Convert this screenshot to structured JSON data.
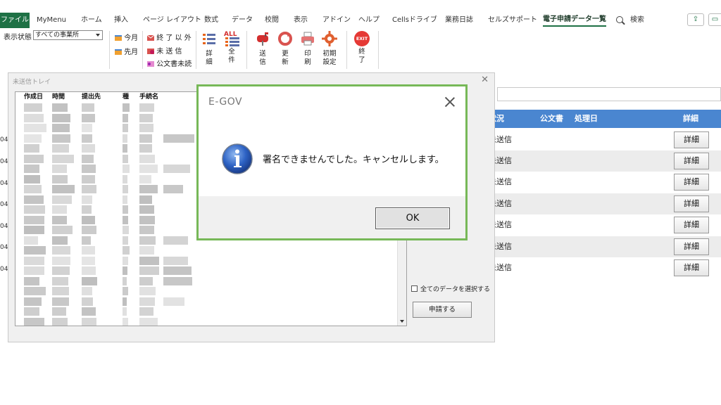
{
  "tabs": {
    "file": "ファイル",
    "items": [
      {
        "key": "mymenu",
        "label": "MyMenu"
      },
      {
        "key": "home",
        "label": "ホーム"
      },
      {
        "key": "insert",
        "label": "挿入"
      },
      {
        "key": "page_layout",
        "label": "ページ レイアウト"
      },
      {
        "key": "formulas",
        "label": "数式"
      },
      {
        "key": "data",
        "label": "データ"
      },
      {
        "key": "review",
        "label": "校閲"
      },
      {
        "key": "view",
        "label": "表示"
      },
      {
        "key": "addins",
        "label": "アドイン"
      },
      {
        "key": "help",
        "label": "ヘルプ"
      },
      {
        "key": "cells_drive",
        "label": "Cellsドライブ"
      },
      {
        "key": "business_log",
        "label": "業務日誌"
      },
      {
        "key": "cells_support",
        "label": "セルズサポート"
      },
      {
        "key": "egov_list",
        "label": "電子申請データ一覧",
        "active": true
      }
    ],
    "search_label": "検索"
  },
  "ribbon": {
    "status_label": "表示状態",
    "status_value": "すべての事業所",
    "this_month": "今月",
    "last_month": "先月",
    "not_completed": "終 了 以 外",
    "not_sent": "未 送 信",
    "doc_unread": "公文書未読",
    "detail": "詳細",
    "all": "全件",
    "send": "送信",
    "update": "更新",
    "print": "印刷",
    "initial_settings": "初期設定",
    "exit": "終了",
    "exit_badge": "EXIT",
    "all_badge": "ALL"
  },
  "sheet": {
    "headers": {
      "status": "状況",
      "document": "公文書",
      "processed_date": "処理日",
      "detail": "詳細"
    },
    "rows": [
      {
        "status": "未送信",
        "button": "詳細"
      },
      {
        "status": "未送信",
        "button": "詳細"
      },
      {
        "status": "未送信",
        "button": "詳細"
      },
      {
        "status": "未送信",
        "button": "詳細"
      },
      {
        "status": "未送信",
        "button": "詳細"
      },
      {
        "status": "未送信",
        "button": "詳細"
      },
      {
        "status": "未送信",
        "button": "詳細"
      }
    ],
    "left_dates": [
      "04",
      "04",
      "04",
      "04",
      "04",
      "04",
      "04"
    ]
  },
  "tray": {
    "title": "未送信トレイ",
    "columns": [
      "作成日",
      "時間",
      "提出先",
      "種",
      "手続名"
    ],
    "select_all_label": "全てのデータを選択する",
    "apply_button": "申請する"
  },
  "dialog": {
    "title": "E-GOV",
    "message": "署名できませんでした。キャンセルします。",
    "ok": "OK"
  },
  "colors": {
    "accent_green": "#1e7145",
    "sheet_header_blue": "#4a86d0",
    "dialog_border": "#77b858"
  }
}
